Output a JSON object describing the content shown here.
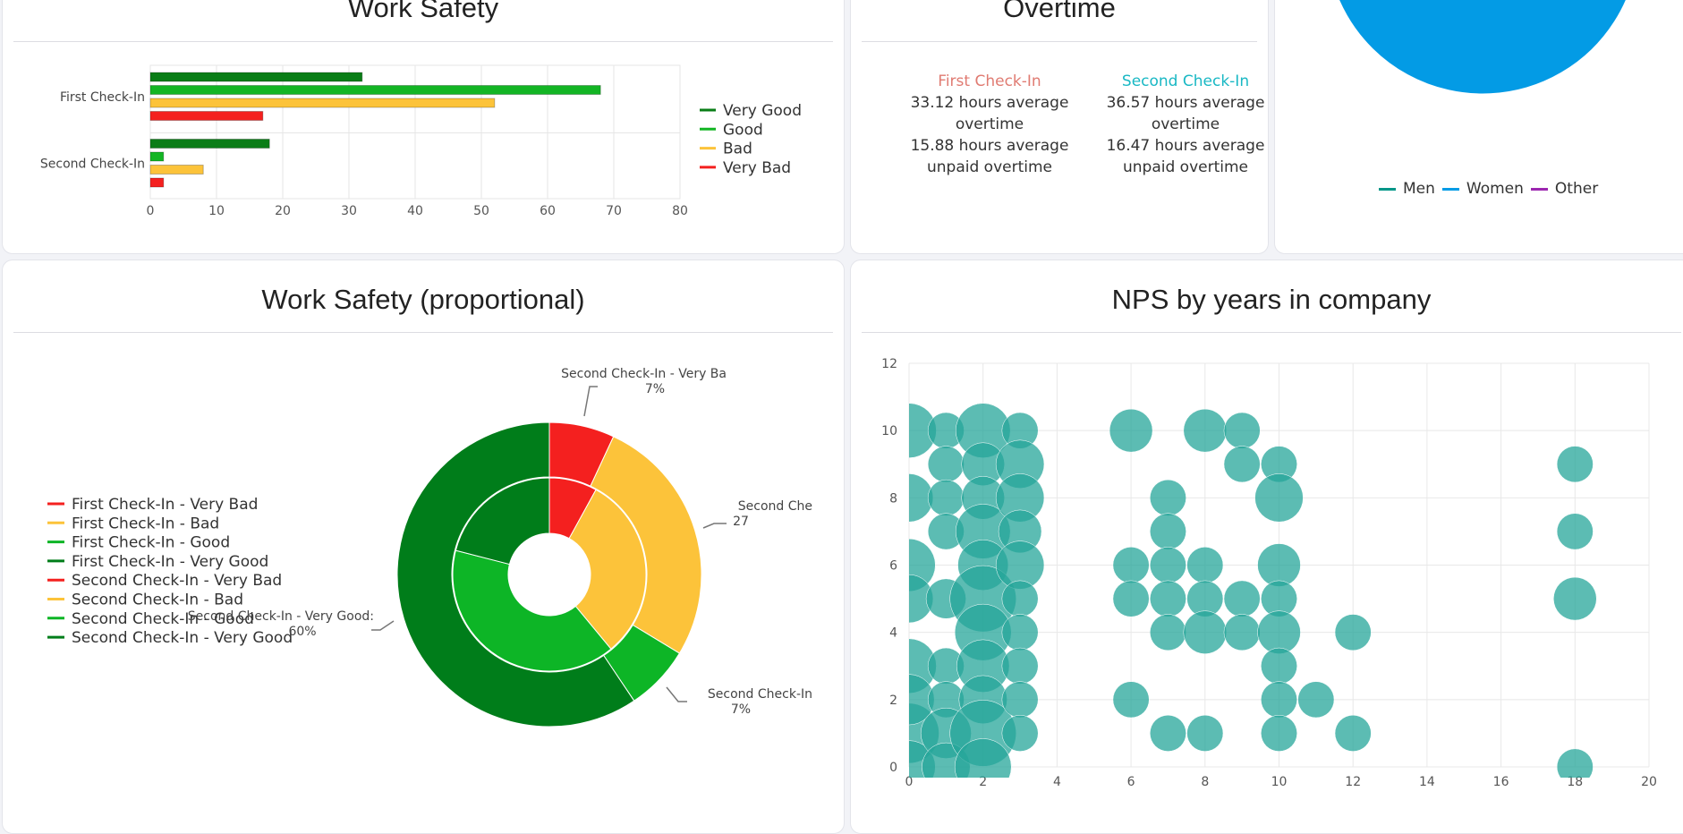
{
  "cards": {
    "work_safety": {
      "title": "Work Safety"
    },
    "overtime": {
      "title": "Overtime",
      "columns": [
        {
          "heading": "First Check-In",
          "color": "#e07b72",
          "line1": "33.12 hours average",
          "line2": "overtime",
          "line3": "15.88 hours average",
          "line4": "unpaid overtime"
        },
        {
          "heading": "Second Check-In",
          "color": "#19b8c4",
          "line1": "36.57 hours average",
          "line2": "overtime",
          "line3": "16.47 hours average",
          "line4": "unpaid overtime"
        }
      ]
    },
    "gender": {
      "legend": [
        {
          "label": "Men",
          "color": "#009688"
        },
        {
          "label": "Women",
          "color": "#039be5"
        },
        {
          "label": "Other",
          "color": "#9c27b0"
        }
      ]
    },
    "work_safety_prop": {
      "title": "Work Safety (proportional)"
    },
    "nps": {
      "title": "NPS by years in company"
    }
  },
  "chart_data": [
    {
      "type": "bar",
      "orientation": "horizontal",
      "title": "Work Safety",
      "categories": [
        "First Check-In",
        "Second Check-In"
      ],
      "series": [
        {
          "name": "Very Good",
          "color": "#0a7d17",
          "values": [
            32,
            18
          ]
        },
        {
          "name": "Good",
          "color": "#13b524",
          "values": [
            68,
            2
          ]
        },
        {
          "name": "Bad",
          "color": "#fcc33a",
          "values": [
            52,
            8
          ]
        },
        {
          "name": "Very Bad",
          "color": "#f4201f",
          "values": [
            17,
            2
          ]
        }
      ],
      "xlim": [
        0,
        80
      ],
      "xticks": [
        0,
        10,
        20,
        30,
        40,
        50,
        60,
        70,
        80
      ],
      "grid": true,
      "legend_position": "right"
    },
    {
      "type": "pie",
      "title": "",
      "slices": [
        {
          "label": "Men",
          "value": 1,
          "color": "#009688"
        },
        {
          "label": "Women",
          "value": 98,
          "color": "#039be5"
        },
        {
          "label": "Other",
          "value": 1,
          "color": "#9c27b0"
        }
      ],
      "legend_position": "bottom"
    },
    {
      "type": "pie",
      "subtype": "nested-donut",
      "title": "Work Safety (proportional)",
      "inner_ring": [
        {
          "label": "First Check-In - Very Bad",
          "value": 8,
          "color": "#f4201f"
        },
        {
          "label": "First Check-In - Bad",
          "value": 31,
          "color": "#fcc33a"
        },
        {
          "label": "First Check-In - Good",
          "value": 40,
          "color": "#0db526"
        },
        {
          "label": "First Check-In - Very Good",
          "value": 21,
          "color": "#007d1a"
        }
      ],
      "outer_ring": [
        {
          "label": "Second Check-In - Very Bad",
          "value": 7,
          "color": "#f4201f"
        },
        {
          "label": "Second Check-In - Bad",
          "value": 27,
          "color": "#fcc33a"
        },
        {
          "label": "Second Check-In - Good",
          "value": 7,
          "color": "#0db526"
        },
        {
          "label": "Second Check-In - Very Good",
          "value": 60,
          "color": "#007d1a"
        }
      ],
      "annotations": [
        {
          "text": "Second Check-In - Very Ba",
          "pct": "7%"
        },
        {
          "text": "Second Che",
          "pct": "27"
        },
        {
          "text": "Second Check-In",
          "pct": "7%"
        },
        {
          "text": "Second Check-In - Very Good:",
          "pct": "60%"
        }
      ],
      "legend_position": "left"
    },
    {
      "type": "scatter",
      "subtype": "bubble",
      "title": "NPS by years in company",
      "color": "#26a69a",
      "xlim": [
        0,
        20
      ],
      "ylim": [
        0,
        12
      ],
      "xticks": [
        0,
        2,
        4,
        6,
        8,
        10,
        12,
        14,
        16,
        18,
        20
      ],
      "yticks": [
        0,
        2,
        4,
        6,
        8,
        10,
        12
      ],
      "grid": true,
      "points": [
        {
          "x": 0,
          "y": 10,
          "size": 9
        },
        {
          "x": 0,
          "y": 8,
          "size": 6
        },
        {
          "x": 0,
          "y": 6,
          "size": 8
        },
        {
          "x": 0,
          "y": 5,
          "size": 6
        },
        {
          "x": 0,
          "y": 3,
          "size": 9
        },
        {
          "x": 0,
          "y": 1,
          "size": 12
        },
        {
          "x": 0,
          "y": 0,
          "size": 8
        },
        {
          "x": 0,
          "y": 2,
          "size": 7
        },
        {
          "x": 1,
          "y": 10,
          "size": 2
        },
        {
          "x": 1,
          "y": 9,
          "size": 2
        },
        {
          "x": 1,
          "y": 8,
          "size": 2
        },
        {
          "x": 1,
          "y": 7,
          "size": 2
        },
        {
          "x": 1,
          "y": 5,
          "size": 3
        },
        {
          "x": 1,
          "y": 3,
          "size": 2
        },
        {
          "x": 1,
          "y": 2,
          "size": 2
        },
        {
          "x": 1,
          "y": 1,
          "size": 7
        },
        {
          "x": 1,
          "y": 0,
          "size": 6
        },
        {
          "x": 2,
          "y": 10,
          "size": 9
        },
        {
          "x": 2,
          "y": 9,
          "size": 4
        },
        {
          "x": 2,
          "y": 8,
          "size": 4
        },
        {
          "x": 2,
          "y": 7,
          "size": 9
        },
        {
          "x": 2,
          "y": 6,
          "size": 7
        },
        {
          "x": 2,
          "y": 5,
          "size": 16
        },
        {
          "x": 2,
          "y": 4,
          "size": 10
        },
        {
          "x": 2,
          "y": 3,
          "size": 8
        },
        {
          "x": 2,
          "y": 2,
          "size": 6
        },
        {
          "x": 2,
          "y": 1,
          "size": 16
        },
        {
          "x": 2,
          "y": 0,
          "size": 10
        },
        {
          "x": 3,
          "y": 10,
          "size": 2
        },
        {
          "x": 3,
          "y": 9,
          "size": 6
        },
        {
          "x": 3,
          "y": 8,
          "size": 6
        },
        {
          "x": 3,
          "y": 7,
          "size": 4
        },
        {
          "x": 3,
          "y": 6,
          "size": 6
        },
        {
          "x": 3,
          "y": 5,
          "size": 2
        },
        {
          "x": 3,
          "y": 4,
          "size": 2
        },
        {
          "x": 3,
          "y": 3,
          "size": 2
        },
        {
          "x": 3,
          "y": 2,
          "size": 2
        },
        {
          "x": 3,
          "y": 1,
          "size": 2
        },
        {
          "x": 6,
          "y": 10,
          "size": 4
        },
        {
          "x": 6,
          "y": 6,
          "size": 2
        },
        {
          "x": 6,
          "y": 5,
          "size": 2
        },
        {
          "x": 6,
          "y": 2,
          "size": 2
        },
        {
          "x": 7,
          "y": 8,
          "size": 2
        },
        {
          "x": 7,
          "y": 7,
          "size": 2
        },
        {
          "x": 7,
          "y": 6,
          "size": 2
        },
        {
          "x": 7,
          "y": 5,
          "size": 2
        },
        {
          "x": 7,
          "y": 4,
          "size": 2
        },
        {
          "x": 7,
          "y": 1,
          "size": 2
        },
        {
          "x": 8,
          "y": 10,
          "size": 4
        },
        {
          "x": 8,
          "y": 6,
          "size": 2
        },
        {
          "x": 8,
          "y": 5,
          "size": 2
        },
        {
          "x": 8,
          "y": 4,
          "size": 4
        },
        {
          "x": 8,
          "y": 1,
          "size": 2
        },
        {
          "x": 9,
          "y": 10,
          "size": 2
        },
        {
          "x": 9,
          "y": 9,
          "size": 2
        },
        {
          "x": 9,
          "y": 5,
          "size": 2
        },
        {
          "x": 9,
          "y": 4,
          "size": 2
        },
        {
          "x": 10,
          "y": 9,
          "size": 2
        },
        {
          "x": 10,
          "y": 8,
          "size": 6
        },
        {
          "x": 10,
          "y": 6,
          "size": 4
        },
        {
          "x": 10,
          "y": 5,
          "size": 2
        },
        {
          "x": 10,
          "y": 4,
          "size": 4
        },
        {
          "x": 10,
          "y": 3,
          "size": 2
        },
        {
          "x": 10,
          "y": 2,
          "size": 2
        },
        {
          "x": 10,
          "y": 1,
          "size": 2
        },
        {
          "x": 11,
          "y": 2,
          "size": 2
        },
        {
          "x": 12,
          "y": 4,
          "size": 2
        },
        {
          "x": 12,
          "y": 1,
          "size": 2
        },
        {
          "x": 18,
          "y": 9,
          "size": 2
        },
        {
          "x": 18,
          "y": 7,
          "size": 2
        },
        {
          "x": 18,
          "y": 5,
          "size": 4
        },
        {
          "x": 18,
          "y": 0,
          "size": 2
        }
      ]
    }
  ]
}
